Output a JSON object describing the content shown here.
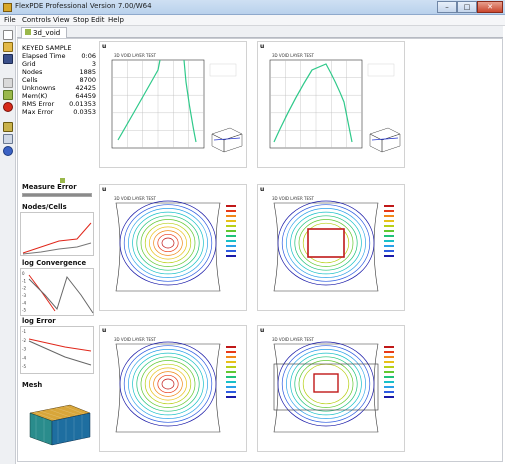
{
  "window": {
    "title": "FlexPDE Professional Version 7.00/W64",
    "min_label": "–",
    "max_label": "□",
    "close_label": "✕"
  },
  "menu": [
    "File",
    "Controls",
    "View",
    "Stop",
    "Edit",
    "Help"
  ],
  "toolbar_icons": [
    "new-file-icon",
    "open-folder-icon",
    "save-icon",
    "print-icon",
    "lightning-icon",
    "stop-icon",
    "edit-icon",
    "export-icon",
    "help-icon"
  ],
  "tab": {
    "label": "3d_void"
  },
  "stats": {
    "header": "KEYED SAMPLE",
    "rows": [
      {
        "label": "Elapsed Time",
        "value": "0:06"
      },
      {
        "label": "Grid",
        "value": "3"
      },
      {
        "label": "Nodes",
        "value": "1885"
      },
      {
        "label": "Cells",
        "value": "8700"
      },
      {
        "label": "Unknowns",
        "value": "42425"
      },
      {
        "label": "Mem(K)",
        "value": "64459"
      },
      {
        "label": "RMS Error",
        "value": "0.01353"
      },
      {
        "label": "Max Error",
        "value": "0.0353"
      }
    ]
  },
  "sections": {
    "measure_error": "Measure Error",
    "nodes_cells": "Nodes/Cells",
    "log_convergence": "log Convergence",
    "log_error": "log Error",
    "mesh": "Mesh"
  },
  "measure_error_progress": 1.0,
  "convergence_ticks": [
    "0",
    "-1",
    "-2",
    "-3",
    "-4",
    "-5"
  ],
  "error_ticks": [
    "-1",
    "-2",
    "-3",
    "-4",
    "-5"
  ],
  "panels": [
    {
      "tag": "u",
      "title": "3D VOID LAYER TEST",
      "kind": "profile",
      "variant": "a"
    },
    {
      "tag": "u",
      "title": "3D VOID LAYER TEST",
      "kind": "profile",
      "variant": "b"
    },
    {
      "tag": "u",
      "title": "3D VOID LAYER TEST",
      "kind": "contour",
      "variant": "a"
    },
    {
      "tag": "u",
      "title": "3D VOID LAYER TEST",
      "kind": "contour",
      "variant": "b"
    },
    {
      "tag": "u",
      "title": "3D VOID LAYER TEST",
      "kind": "contour",
      "variant": "a"
    },
    {
      "tag": "u",
      "title": "3D VOID LAYER TEST",
      "kind": "contour",
      "variant": "c"
    }
  ]
}
